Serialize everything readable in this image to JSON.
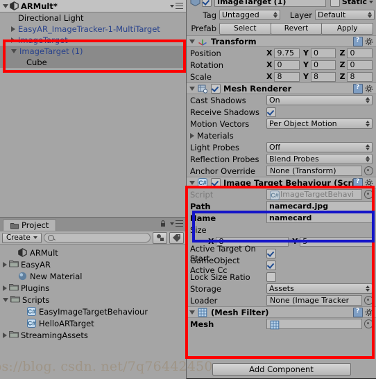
{
  "hierarchy": {
    "scene_name": "ARMult*",
    "scene_icon": "unity-scene-icon",
    "menu_icon": "panel-menu-icon",
    "items": [
      {
        "label": "Directional Light",
        "indent": 1,
        "arrow": "none",
        "prefab": false,
        "selected": false
      },
      {
        "label": "EasyAR_ImageTracker-1-MultiTarget",
        "indent": 1,
        "arrow": "right",
        "prefab": true,
        "selected": false
      },
      {
        "label": "ImageTarget",
        "indent": 1,
        "arrow": "right",
        "prefab": true,
        "selected": false
      },
      {
        "label": "ImageTarget (1)",
        "indent": 1,
        "arrow": "down",
        "prefab": true,
        "selected": true
      },
      {
        "label": "Cube",
        "indent": 2,
        "arrow": "none",
        "prefab": false,
        "selected": true
      }
    ]
  },
  "project": {
    "tab_label": "Project",
    "tab_icon": "folder-icon",
    "lock_icon": "lock-icon",
    "menu_icon": "panel-menu-icon",
    "create_label": "Create",
    "search_placeholder": "",
    "search_value": "",
    "filter_icon_1": "search-by-type-icon",
    "filter_icon_2": "search-by-label-icon",
    "items": [
      {
        "label": "ARMult",
        "indent": 1,
        "arrow": "none",
        "icon": "unity-scene-icon"
      },
      {
        "label": "EasyAR",
        "indent": 0,
        "arrow": "right",
        "icon": "folder-icon"
      },
      {
        "label": "New Material",
        "indent": 1,
        "arrow": "none",
        "icon": "material-icon"
      },
      {
        "label": "Plugins",
        "indent": 0,
        "arrow": "right",
        "icon": "folder-icon"
      },
      {
        "label": "Scripts",
        "indent": 0,
        "arrow": "down",
        "icon": "folder-icon"
      },
      {
        "label": "EasyImageTargetBehaviour",
        "indent": 2,
        "arrow": "none",
        "icon": "cs-script-icon"
      },
      {
        "label": "HelloARTarget",
        "indent": 2,
        "arrow": "none",
        "icon": "cs-script-icon"
      },
      {
        "label": "StreamingAssets",
        "indent": 0,
        "arrow": "right",
        "icon": "folder-icon"
      }
    ]
  },
  "inspector": {
    "object_name": "ImageTarget (1)",
    "enabled": true,
    "static_label": "Static",
    "static_checked": false,
    "tag_label": "Tag",
    "tag_value": "Untagged",
    "layer_label": "Layer",
    "layer_value": "Default",
    "prefab_label": "Prefab",
    "prefab_buttons": [
      "Select",
      "Revert",
      "Apply"
    ],
    "components": [
      {
        "name": "Transform",
        "icon": "transform-icon",
        "has_checkbox": false,
        "rows": [
          {
            "type": "vec3",
            "label": "Position",
            "x": "9.75",
            "y": "0",
            "z": "0"
          },
          {
            "type": "vec3",
            "label": "Rotation",
            "x": "0",
            "y": "0",
            "z": "0"
          },
          {
            "type": "vec3",
            "label": "Scale",
            "x": "8",
            "y": "8",
            "z": "8"
          }
        ]
      },
      {
        "name": "Mesh Renderer",
        "icon": "mesh-renderer-icon",
        "has_checkbox": true,
        "checked": true,
        "rows": [
          {
            "type": "dropdown",
            "label": "Cast Shadows",
            "value": "On"
          },
          {
            "type": "checkbox",
            "label": "Receive Shadows",
            "checked": true
          },
          {
            "type": "dropdown",
            "label": "Motion Vectors",
            "value": "Per Object Motion"
          },
          {
            "type": "foldout",
            "label": "Materials"
          },
          {
            "type": "dropdown",
            "label": "Light Probes",
            "value": "Off"
          },
          {
            "type": "dropdown",
            "label": "Reflection Probes",
            "value": "Blend Probes"
          },
          {
            "type": "object",
            "label": "Anchor Override",
            "value": "None (Transform)"
          }
        ]
      },
      {
        "name": "Image Target Behaviour (Script)",
        "icon": "cs-script-icon",
        "has_checkbox": true,
        "checked": true,
        "rows": [
          {
            "type": "object_dis",
            "label": "Script",
            "value": "ImageTargetBehavi"
          },
          {
            "type": "text",
            "label": "Path",
            "value": "namecard.jpg"
          },
          {
            "type": "text",
            "label": "Name",
            "value": "namecard"
          },
          {
            "type": "header",
            "label": "Size"
          },
          {
            "type": "vec2",
            "label": "",
            "x": "8",
            "y": "5"
          },
          {
            "type": "checkbox",
            "label": "Active Target On Start",
            "checked": true
          },
          {
            "type": "checkbox",
            "label": "GameObject Active Cc",
            "checked": true
          },
          {
            "type": "checkbox",
            "label": "Lock Size Ratio",
            "checked": false
          },
          {
            "type": "dropdown",
            "label": "Storage",
            "value": "Assets"
          },
          {
            "type": "object",
            "label": "Loader",
            "value": "None (Image Tracker"
          }
        ]
      },
      {
        "name": "(Mesh Filter)",
        "icon": "mesh-filter-icon",
        "has_checkbox": false,
        "rows": [
          {
            "type": "mesh",
            "label": "Mesh",
            "value": ""
          }
        ]
      }
    ],
    "add_component_label": "Add Component"
  },
  "watermark": "https://blog. csdn. net/7q76442450",
  "colors": {
    "highlight_red": "#fe0000",
    "highlight_blue": "#1414c8",
    "panel_bg": "#a5a5a5",
    "prefab_text": "#27418c"
  }
}
